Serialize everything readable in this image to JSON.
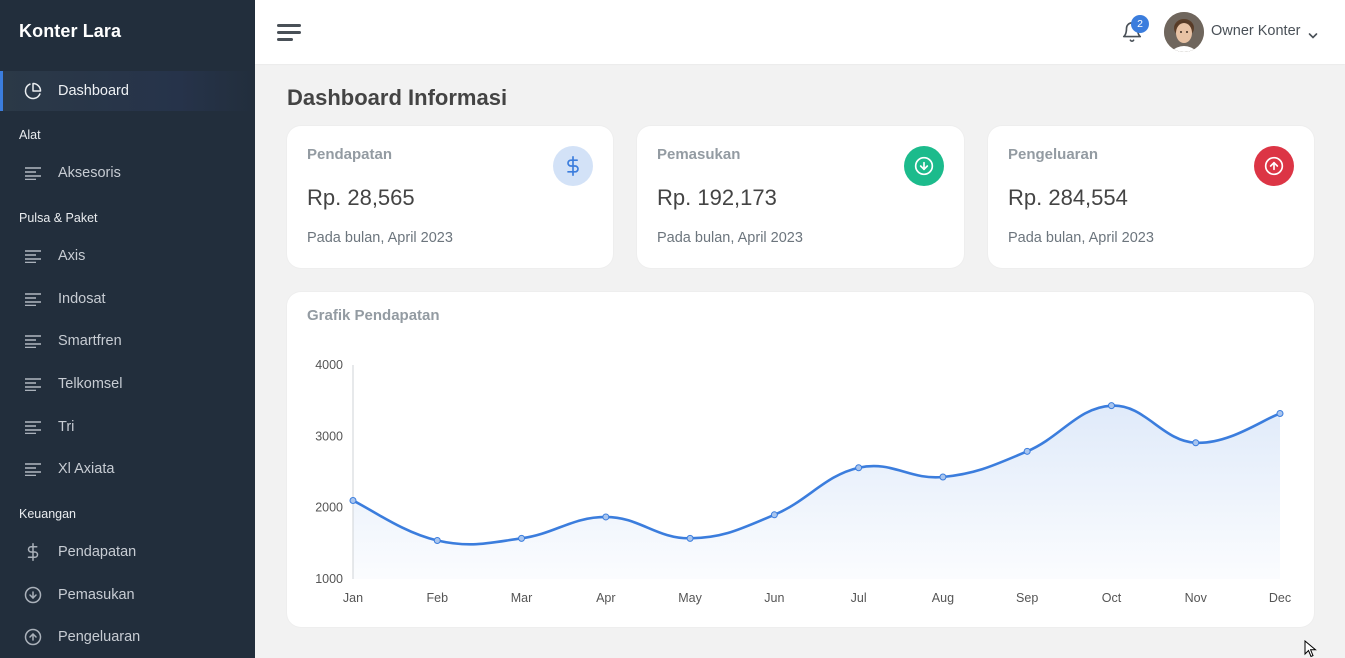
{
  "sidebar": {
    "brand": "Konter Lara",
    "dashboard": "Dashboard",
    "sections": {
      "alat": "Alat",
      "pulsa": "Pulsa & Paket",
      "keuangan": "Keuangan"
    },
    "items": {
      "aksesoris": "Aksesoris",
      "axis": "Axis",
      "indosat": "Indosat",
      "smartfren": "Smartfren",
      "telkomsel": "Telkomsel",
      "tri": "Tri",
      "xl": "Xl Axiata",
      "pendapatan": "Pendapatan",
      "pemasukan": "Pemasukan",
      "pengeluaran": "Pengeluaran"
    }
  },
  "topbar": {
    "notification_count": "2",
    "user_name": "Owner Konter"
  },
  "page": {
    "title_strong": "Dashboard",
    "title_rest": "Informasi"
  },
  "cards": [
    {
      "title": "Pendapatan",
      "value": "Rp. 28,565",
      "subtitle": "Pada bulan, April 2023",
      "icon": "dollar-icon",
      "color": "#d3e2f7"
    },
    {
      "title": "Pemasukan",
      "value": "Rp. 192,173",
      "subtitle": "Pada bulan, April 2023",
      "icon": "arrow-down-circle-icon",
      "color": "#1cbb8c"
    },
    {
      "title": "Pengeluaran",
      "value": "Rp. 284,554",
      "subtitle": "Pada bulan, April 2023",
      "icon": "arrow-up-circle-icon",
      "color": "#dc3545"
    }
  ],
  "chart_title": "Grafik Pendapatan",
  "chart_data": {
    "type": "area",
    "categories": [
      "Jan",
      "Feb",
      "Mar",
      "Apr",
      "May",
      "Jun",
      "Jul",
      "Aug",
      "Sep",
      "Oct",
      "Nov",
      "Dec"
    ],
    "values": [
      2100,
      1540,
      1570,
      1870,
      1570,
      1900,
      2560,
      2430,
      2790,
      3430,
      2910,
      3320
    ],
    "ylim": [
      1000,
      4000
    ],
    "yticks": [
      1000,
      2000,
      3000,
      4000
    ],
    "line_color": "#3b7ddd",
    "grid": false,
    "legend": "none"
  }
}
